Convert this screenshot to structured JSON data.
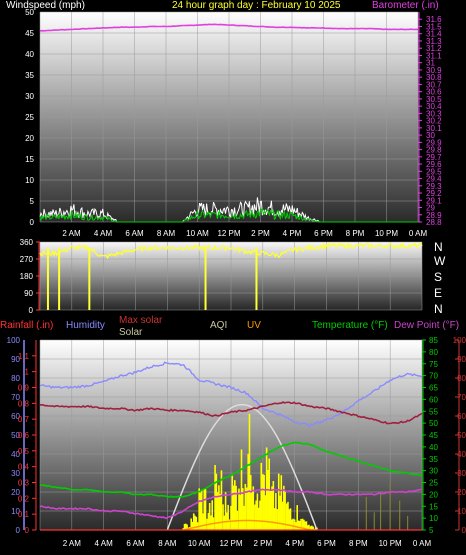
{
  "header": {
    "windspeed_label": "Windspeed (mph)",
    "title": "24 hour graph day : February 10 2025",
    "barometer_label": "Barometer (.in)"
  },
  "compass": [
    "N",
    "W",
    "S",
    "E",
    "N"
  ],
  "legend": {
    "rainfall": "Rainfall (.in)",
    "humidity": "Humidity",
    "max_solar": "Max solar",
    "solar": "Solar",
    "aqi": "AQI",
    "uv": "UV",
    "temperature": "Temperature (°F)",
    "dew_point": "Dew Point (°F)"
  },
  "colors": {
    "windspeed": "#ffffff",
    "gust": "#00cc00",
    "barometer": "#e040e0",
    "direction": "#ffff33",
    "rainfall": "#ff3333",
    "humidity": "#8a8aff",
    "max_solar": "#cc3333",
    "solar": "#ffff00",
    "aqi": "#c8c8a0",
    "uv": "#ff9900",
    "temperature": "#00cc00",
    "dew_point": "#cc44cc"
  },
  "x_tick_labels": [
    "2 AM",
    "4 AM",
    "6 AM",
    "8 AM",
    "10 AM",
    "12 PM",
    "2 PM",
    "4 PM",
    "6 PM",
    "8 PM",
    "10 PM",
    "0 AM"
  ],
  "chart_data": [
    {
      "type": "line",
      "title": "24 hour graph day : February 10 2025",
      "x_hours": [
        0,
        1,
        2,
        3,
        4,
        5,
        6,
        7,
        8,
        9,
        10,
        11,
        12,
        13,
        14,
        15,
        16,
        17,
        18,
        19,
        20,
        21,
        22,
        23,
        24
      ],
      "series": [
        {
          "name": "Windspeed (mph)",
          "axis": "left",
          "values": [
            2,
            2,
            3,
            2,
            2,
            0,
            0,
            0,
            0,
            0,
            3,
            3,
            3,
            3,
            4,
            3,
            3,
            1,
            0,
            0,
            0,
            0,
            0,
            0,
            0
          ]
        },
        {
          "name": "Barometer (.in)",
          "axis": "right",
          "values": [
            31.44,
            31.45,
            31.46,
            31.47,
            31.48,
            31.49,
            31.49,
            31.5,
            31.5,
            31.51,
            31.52,
            31.53,
            31.52,
            31.51,
            31.5,
            31.49,
            31.49,
            31.48,
            31.48,
            31.47,
            31.47,
            31.47,
            31.46,
            31.46,
            31.46
          ]
        }
      ],
      "left_axis": {
        "label": "Windspeed (mph)",
        "ylim": [
          0,
          50
        ],
        "ticks": [
          0,
          5,
          10,
          15,
          20,
          25,
          30,
          35,
          40,
          45,
          50
        ]
      },
      "right_axis": {
        "label": "Barometer (.in)",
        "ylim": [
          28.8,
          31.7
        ],
        "ticks": [
          "28.8",
          "28.9",
          "29",
          "29.1",
          "29.2",
          "29.3",
          "29.4",
          "29.5",
          "29.6",
          "29.7",
          "29.8",
          "29.9",
          "30",
          "30.1",
          "30.2",
          "30.3",
          "30.4",
          "30.5",
          "30.6",
          "30.7",
          "30.8",
          "30.9",
          "31",
          "31.1",
          "31.2",
          "31.3",
          "31.4",
          "31.5",
          "31.6"
        ]
      }
    },
    {
      "type": "line",
      "x_hours": [
        0,
        1,
        2,
        3,
        4,
        5,
        6,
        7,
        8,
        9,
        10,
        11,
        12,
        13,
        14,
        15,
        16,
        17,
        18,
        19,
        20,
        21,
        22,
        23,
        24
      ],
      "series": [
        {
          "name": "Wind direction",
          "values": [
            300,
            300,
            330,
            330,
            280,
            300,
            320,
            330,
            330,
            330,
            330,
            330,
            330,
            310,
            300,
            290,
            320,
            330,
            340,
            340,
            340,
            340,
            340,
            340,
            340
          ]
        }
      ],
      "dips": [
        {
          "hour": 0.5,
          "value": 0
        },
        {
          "hour": 1.2,
          "value": 0
        },
        {
          "hour": 3.1,
          "value": 0
        },
        {
          "hour": 10.4,
          "value": 0
        },
        {
          "hour": 13.6,
          "value": 0
        }
      ],
      "left_axis": {
        "ylim": [
          0,
          360
        ],
        "ticks": [
          0,
          90,
          180,
          270,
          360
        ]
      }
    },
    {
      "type": "line",
      "x_hours": [
        0,
        1,
        2,
        3,
        4,
        5,
        6,
        7,
        8,
        9,
        10,
        11,
        12,
        13,
        14,
        15,
        16,
        17,
        18,
        19,
        20,
        21,
        22,
        23,
        24
      ],
      "series": [
        {
          "name": "Humidity",
          "axis": "humidity",
          "values": [
            76,
            75,
            75,
            76,
            78,
            81,
            83,
            86,
            88,
            87,
            79,
            77,
            75,
            72,
            64,
            61,
            57,
            55,
            58,
            62,
            68,
            73,
            79,
            82,
            81
          ]
        },
        {
          "name": "Temperature (°F)",
          "axis": "temp",
          "values": [
            24,
            23,
            22,
            22,
            21,
            21,
            20,
            20,
            19,
            19,
            21,
            25,
            28,
            32,
            36,
            40,
            42,
            41,
            38,
            36,
            34,
            32,
            30,
            29,
            28
          ]
        },
        {
          "name": "Dew Point (°F)",
          "axis": "temp",
          "values": [
            15,
            14,
            14,
            14,
            13,
            13,
            12,
            11,
            10,
            13,
            17,
            19,
            20,
            21,
            22,
            22,
            21,
            21,
            20,
            20,
            20,
            20,
            21,
            21,
            22
          ]
        },
        {
          "name": "Max solar",
          "axis": "solar",
          "values": [
            66,
            65,
            65,
            65,
            64,
            64,
            63,
            64,
            63,
            63,
            62,
            60,
            62,
            63,
            65,
            67,
            67,
            65,
            64,
            62,
            60,
            58,
            56,
            57,
            61
          ]
        },
        {
          "name": "Rainfall (.in)",
          "axis": "rain",
          "values": [
            0,
            0,
            0,
            0,
            0,
            0,
            0,
            0,
            0,
            0,
            0,
            0,
            0,
            0,
            0,
            0,
            0,
            0,
            0,
            0,
            0,
            0,
            0,
            0,
            0
          ]
        }
      ],
      "solar_curve": {
        "name": "Max solar",
        "peak_hour": 12.7,
        "start_hour": 8,
        "end_hour": 17.4,
        "peak_fraction": 0.66
      },
      "solar_bars": {
        "name": "Solar",
        "hours": [
          9,
          9.5,
          10,
          10.5,
          11,
          11.5,
          12,
          12.5,
          13,
          13.5,
          14,
          14.5,
          15,
          15.5,
          16,
          16.5,
          17
        ],
        "fractions": [
          0.03,
          0.08,
          0.22,
          0.14,
          0.3,
          0.18,
          0.28,
          0.4,
          0.52,
          0.33,
          0.38,
          0.22,
          0.25,
          0.15,
          0.12,
          0.06,
          0.02
        ]
      },
      "humidity_axis": {
        "label": "Humidity",
        "ylim": [
          0,
          100
        ],
        "ticks": [
          0,
          10,
          20,
          30,
          40,
          50,
          60,
          70,
          80,
          90,
          100
        ]
      },
      "rain_axis": {
        "label": "Rainfall (.in)",
        "ylim": [
          0,
          1.2
        ],
        "ticks": [
          "0",
          "0.1",
          "0.2",
          "0.3",
          "0.4",
          "0.5",
          "0.6",
          "0.7",
          "0.8",
          "0.9",
          "1",
          "1.1"
        ]
      },
      "temp_axis": {
        "label": "Temperature (°F)",
        "ylim": [
          5,
          85
        ],
        "ticks": [
          5,
          10,
          15,
          20,
          25,
          30,
          35,
          40,
          45,
          50,
          55,
          60,
          65,
          70,
          75,
          80,
          85
        ]
      },
      "solar_axis": {
        "label": "Max solar",
        "ylim": [
          0,
          100
        ],
        "ticks": [
          0,
          10,
          20,
          30,
          40,
          50,
          60,
          70,
          80,
          90,
          100
        ]
      }
    }
  ]
}
